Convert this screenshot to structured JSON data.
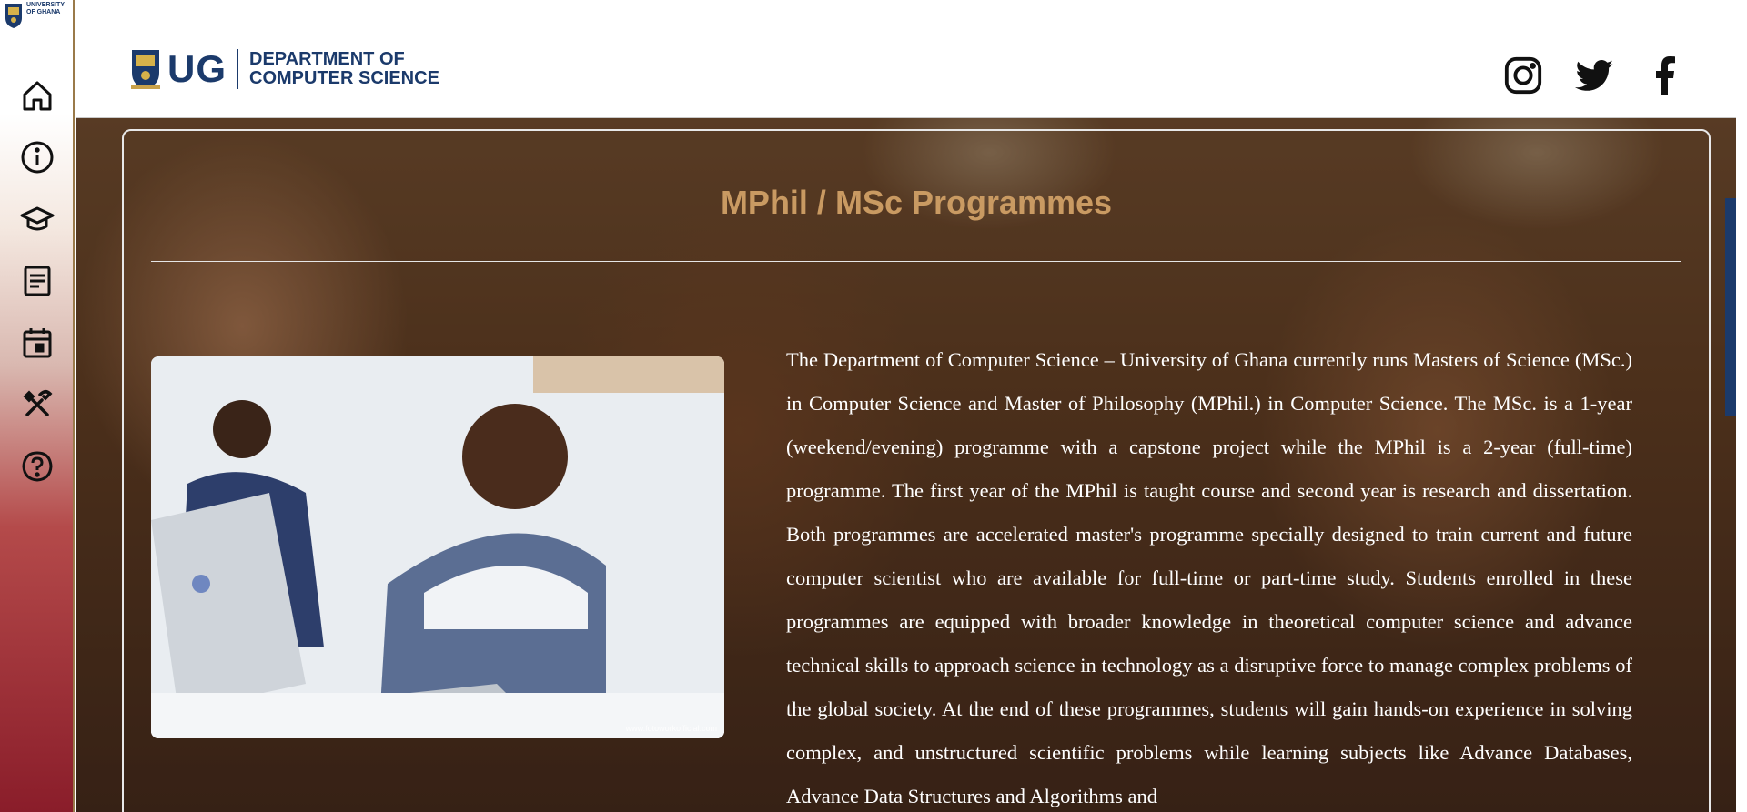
{
  "logo": {
    "mini_text": "UNIVERSITY OF GHANA",
    "short": "UG",
    "dept_line1": "DEPARTMENT OF",
    "dept_line2": "COMPUTER SCIENCE"
  },
  "sidebar": {
    "items": [
      {
        "icon": "home-icon"
      },
      {
        "icon": "info-icon"
      },
      {
        "icon": "graduation-cap-icon"
      },
      {
        "icon": "document-icon"
      },
      {
        "icon": "calendar-icon"
      },
      {
        "icon": "tools-icon"
      },
      {
        "icon": "help-icon"
      }
    ]
  },
  "social": [
    "instagram-icon",
    "twitter-icon",
    "facebook-icon"
  ],
  "page": {
    "title": "MPhil / MSc Programmes",
    "photo_watermark": "www.fotoworkofficial.com",
    "body": "The Department of Computer Science – University of Ghana currently runs Masters of Science (MSc.) in Computer Science and Master of Philosophy (MPhil.) in Computer Science. The MSc. is a 1-year (weekend/evening) programme with a capstone project while the MPhil is a 2-year (full-time) programme. The first year of the MPhil is taught course and second year is research and dissertation. Both programmes are accelerated master's programme specially designed to train current and future computer scientist who are available for full-time or part-time study. Students enrolled in these programmes are equipped with broader knowledge in theoretical computer science and advance technical skills to approach science in technology as a disruptive force to manage complex problems of the global society. At the end of these programmes, students will gain hands-on experience in solving complex, and unstructured scientific problems while learning subjects like Advance Databases, Advance Data Structures and Algorithms and"
  },
  "colors": {
    "brand_blue": "#1b3a6b",
    "title_gold": "#c99a62",
    "sidebar_maroon": "#8a1d2a"
  }
}
